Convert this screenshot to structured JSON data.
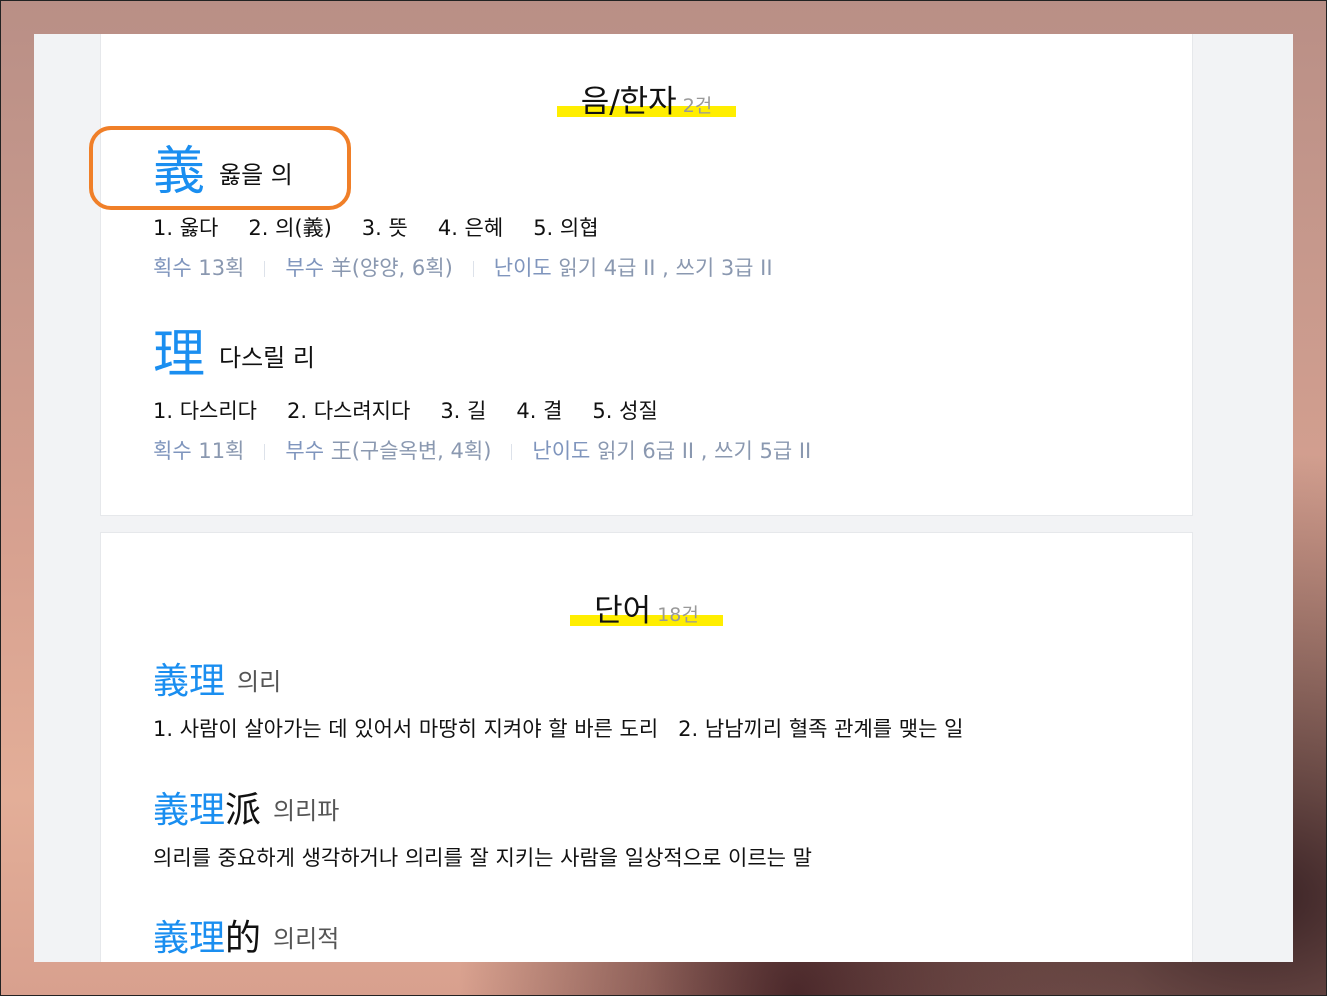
{
  "sections": {
    "hanja": {
      "title": "음/한자",
      "count": "2건",
      "entries": [
        {
          "char": "義",
          "reading": "옳을 의",
          "meanings": [
            "1. 옳다",
            "2. 의(義)",
            "3. 뜻",
            "4. 은혜",
            "5. 의협"
          ],
          "strokes_label": "획수",
          "strokes": "13획",
          "radical_label": "부수",
          "radical": "羊(양양, 6획)",
          "level_label": "난이도",
          "level": "읽기 4급 II , 쓰기 3급 II"
        },
        {
          "char": "理",
          "reading": "다스릴 리",
          "meanings": [
            "1. 다스리다",
            "2. 다스려지다",
            "3. 길",
            "4. 결",
            "5. 성질"
          ],
          "strokes_label": "획수",
          "strokes": "11획",
          "radical_label": "부수",
          "radical": "王(구슬옥변, 4획)",
          "level_label": "난이도",
          "level": "읽기 6급 II , 쓰기 5급 II"
        }
      ]
    },
    "words": {
      "title": "단어",
      "count": "18건",
      "entries": [
        {
          "match": "義理",
          "rest": "",
          "reading": "의리",
          "defs": [
            "1. 사람이 살아가는 데 있어서 마땅히 지켜야 할 바른 도리",
            "2. 남남끼리 혈족 관계를 맺는 일"
          ]
        },
        {
          "match": "義理",
          "rest": "派",
          "reading": "의리파",
          "defs": [
            "의리를 중요하게 생각하거나 의리를 잘 지키는 사람을 일상적으로 이르는 말"
          ]
        },
        {
          "match": "義理",
          "rest": "的",
          "reading": "의리적",
          "defs": []
        }
      ]
    }
  },
  "colors": {
    "accent": "#1a8ef0",
    "highlight": "#ffee00",
    "annotation_box": "#f07f28",
    "meta_text": "#8a98b0"
  }
}
